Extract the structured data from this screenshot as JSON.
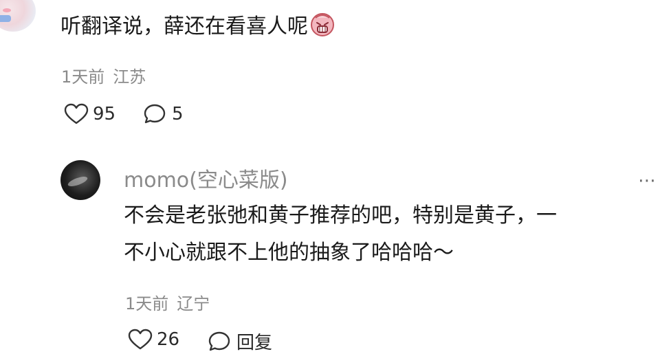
{
  "top_comment": {
    "text": "听翻译说，薛还在看喜人呢",
    "emoji": "crying-face-emoji",
    "time": "1天前",
    "location": "江苏",
    "likes": "95",
    "replies": "5"
  },
  "reply": {
    "username": "momo(空心菜版)",
    "line1": "不会是老张弛和黄子推荐的吧，特别是黄子，一",
    "line2": "不小心就跟不上他的抽象了哈哈哈～",
    "time": "1天前",
    "location": "辽宁",
    "likes": "26",
    "reply_label": "回复",
    "more": "⋯"
  }
}
